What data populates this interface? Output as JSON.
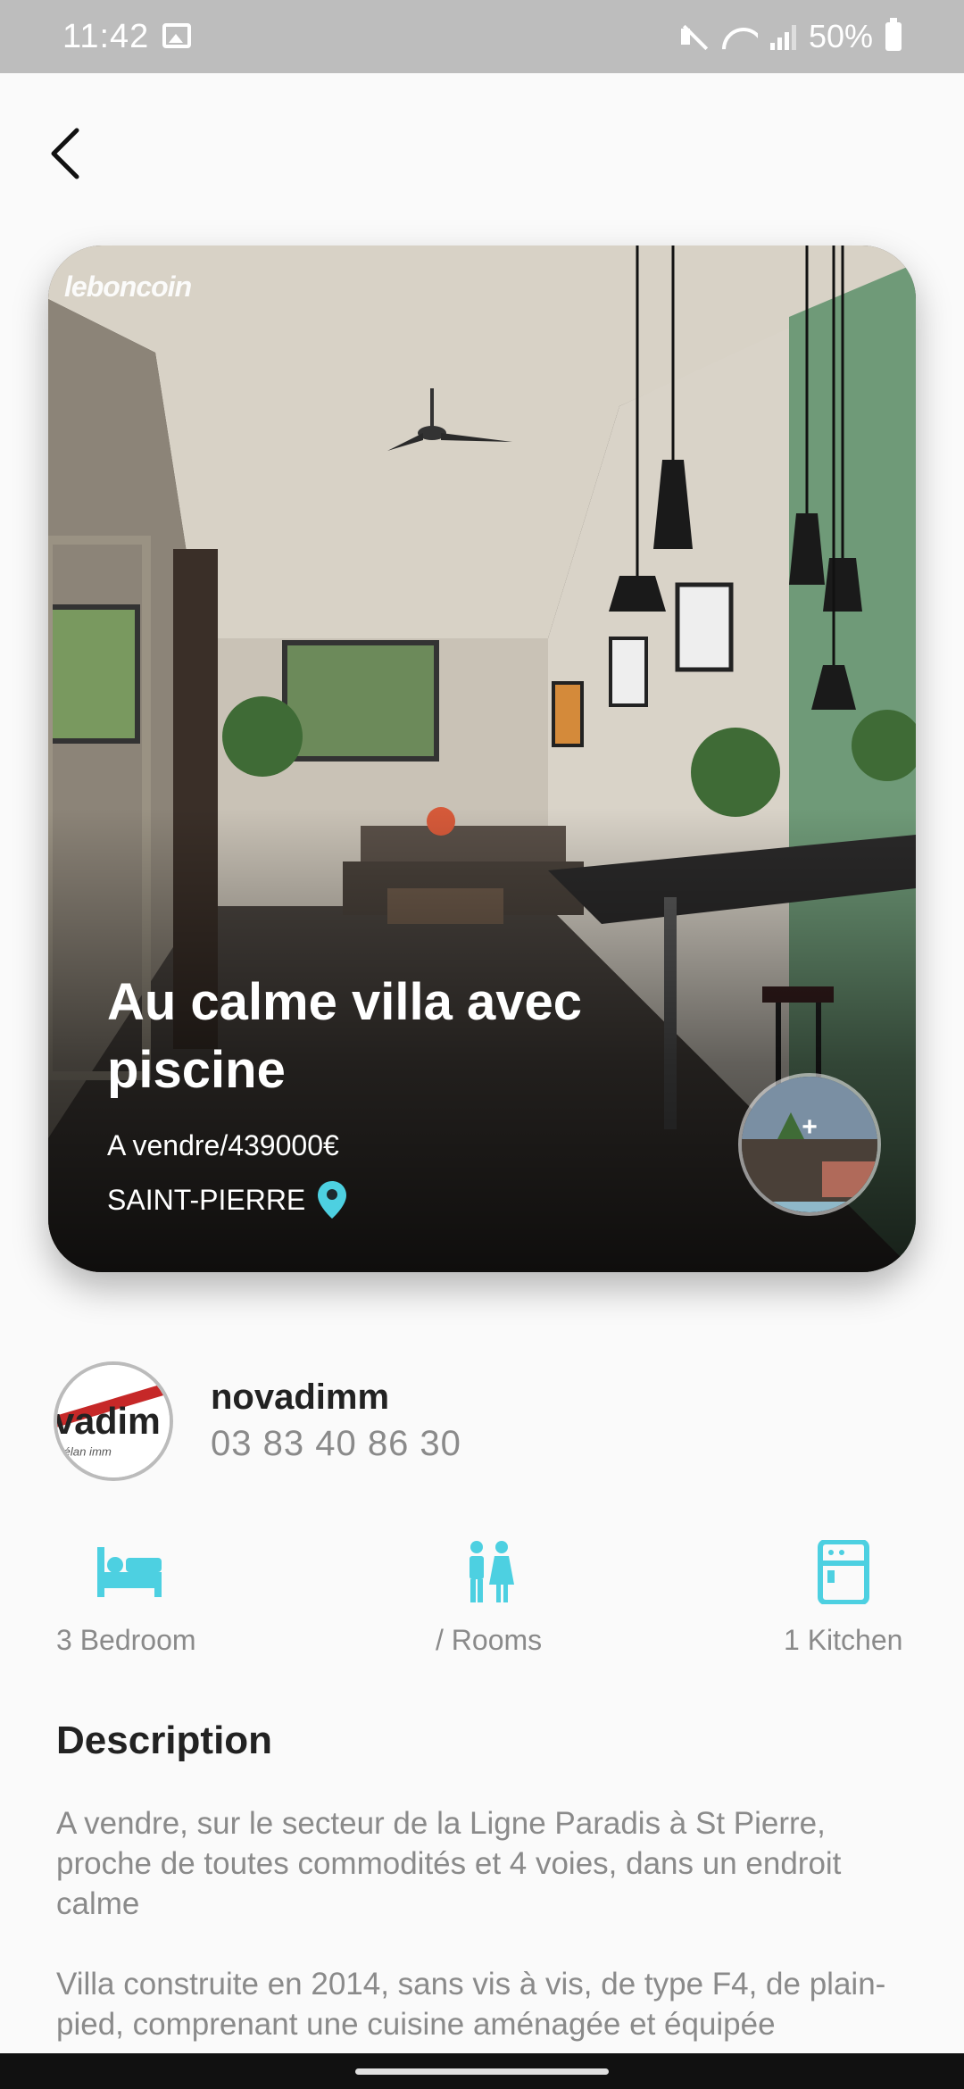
{
  "status_bar": {
    "time": "11:42",
    "battery": "50%"
  },
  "listing": {
    "watermark": "leboncoin",
    "title": "Au calme villa avec piscine",
    "price": "A vendre/439000€",
    "location": "SAINT-PIERRE",
    "gallery_more": "+"
  },
  "agent": {
    "logo_text": "vadim",
    "logo_subtext": "élan imm",
    "name": "novadimm",
    "phone": "03 83 40 86 30"
  },
  "features": [
    {
      "label": "3 Bedroom",
      "icon": "bed-icon"
    },
    {
      "label": "/ Rooms",
      "icon": "people-icon"
    },
    {
      "label": "1 Kitchen",
      "icon": "kitchen-icon"
    }
  ],
  "description": {
    "heading": "Description",
    "text": "A vendre, sur le secteur de la Ligne Paradis à St Pierre, proche de toutes commodités et 4 voies, dans un endroit calme\n\nVilla construite en 2014, sans vis à vis, de type F4, de plain-pied, comprenant une cuisine aménagée et équipée"
  },
  "colors": {
    "accent": "#4dd0e1",
    "status_bar": "#bdbdbd",
    "muted_text": "#8a8a8a"
  }
}
